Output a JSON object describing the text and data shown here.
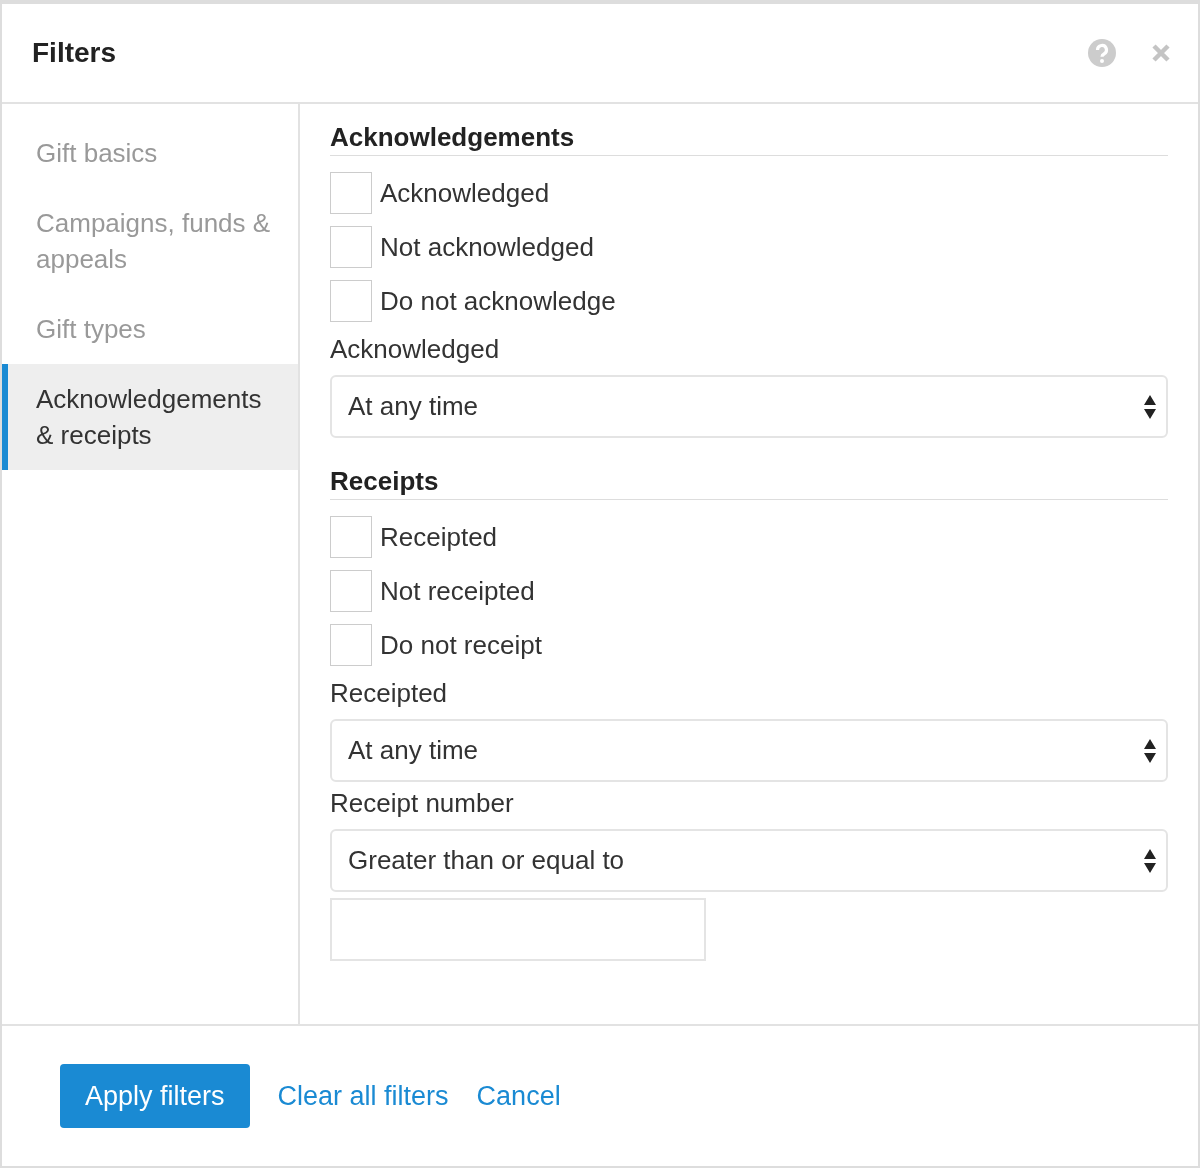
{
  "dialog": {
    "title": "Filters"
  },
  "sidebar": {
    "items": [
      {
        "label": "Gift basics",
        "selected": false
      },
      {
        "label": "Campaigns, funds & appeals",
        "selected": false
      },
      {
        "label": "Gift types",
        "selected": false
      },
      {
        "label": "Acknowledgements & receipts",
        "selected": true
      }
    ]
  },
  "sections": [
    {
      "heading": "Acknowledgements",
      "checkboxes": [
        {
          "label": "Acknowledged",
          "checked": false
        },
        {
          "label": "Not acknowledged",
          "checked": false
        },
        {
          "label": "Do not acknowledge",
          "checked": false
        }
      ],
      "fields": [
        {
          "kind": "select",
          "label": "Acknowledged",
          "value": "At any time"
        }
      ]
    },
    {
      "heading": "Receipts",
      "checkboxes": [
        {
          "label": "Receipted",
          "checked": false
        },
        {
          "label": "Not receipted",
          "checked": false
        },
        {
          "label": "Do not receipt",
          "checked": false
        }
      ],
      "fields": [
        {
          "kind": "select",
          "label": "Receipted",
          "value": "At any time"
        },
        {
          "kind": "select",
          "label": "Receipt number",
          "value": "Greater than or equal to"
        },
        {
          "kind": "input"
        }
      ]
    }
  ],
  "footer": {
    "buttons": [
      {
        "label": "Apply filters",
        "kind": "primary"
      },
      {
        "label": "Clear all filters",
        "kind": "link"
      },
      {
        "label": "Cancel",
        "kind": "link"
      }
    ]
  }
}
